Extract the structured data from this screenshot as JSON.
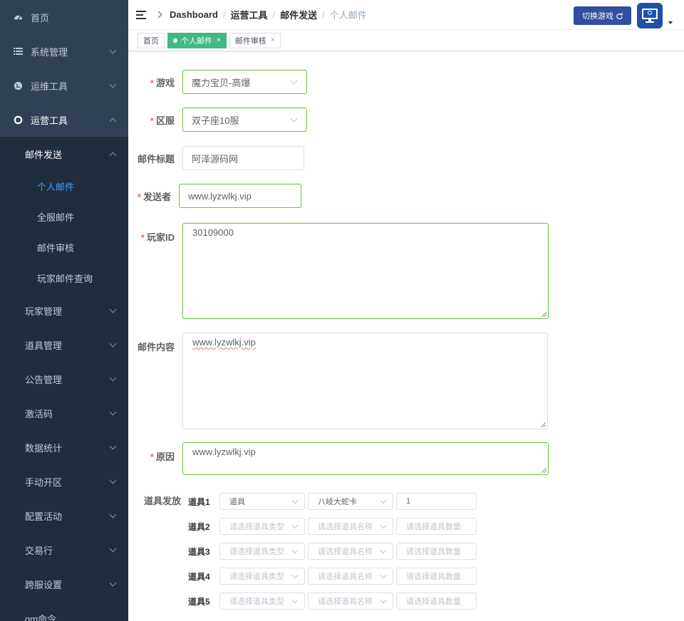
{
  "sidebar": {
    "home": "首页",
    "system": "系统管理",
    "ops_tools": "运维工具",
    "operation_tools": "运营工具",
    "mail_send": "邮件发送",
    "mail_items": [
      "个人邮件",
      "全服邮件",
      "邮件审核",
      "玩家邮件查询"
    ],
    "groups": [
      "玩家管理",
      "道具管理",
      "公告管理",
      "激活码",
      "数据统计",
      "手动开区",
      "配置活动",
      "交易行",
      "跨服设置",
      "gm命令"
    ]
  },
  "navbar": {
    "breadcrumb": [
      "Dashboard",
      "运营工具",
      "邮件发送",
      "个人邮件"
    ],
    "switch_label": "切换游戏"
  },
  "tags": {
    "home": "首页",
    "personal_mail": "个人邮件",
    "mail_review": "邮件审核"
  },
  "form": {
    "game_label": "游戏",
    "game_value": "魔力宝贝-高爆",
    "server_label": "区服",
    "server_value": "双子座10服",
    "title_label": "邮件标题",
    "title_value": "阿泽源码网",
    "sender_label": "发送者",
    "sender_value": "www.lyzwlkj.vip",
    "player_label": "玩家ID",
    "player_value": "30109000",
    "content_label": "邮件内容",
    "content_value": "www.lyzwlkj.vip",
    "reason_label": "原因",
    "reason_value": "www.lyzwlkj.vip",
    "props_label": "道具发放",
    "props": [
      {
        "label": "道具1",
        "type": "道具",
        "name": "八岐大蛇卡",
        "count": "1"
      },
      {
        "label": "道具2",
        "type": "",
        "name": "",
        "count": ""
      },
      {
        "label": "道具3",
        "type": "",
        "name": "",
        "count": ""
      },
      {
        "label": "道具4",
        "type": "",
        "name": "",
        "count": ""
      },
      {
        "label": "道具5",
        "type": "",
        "name": "",
        "count": ""
      }
    ],
    "type_placeholder": "请选择道具类型",
    "name_placeholder": "请选择道具名称",
    "count_placeholder": "请选择道具数量"
  }
}
